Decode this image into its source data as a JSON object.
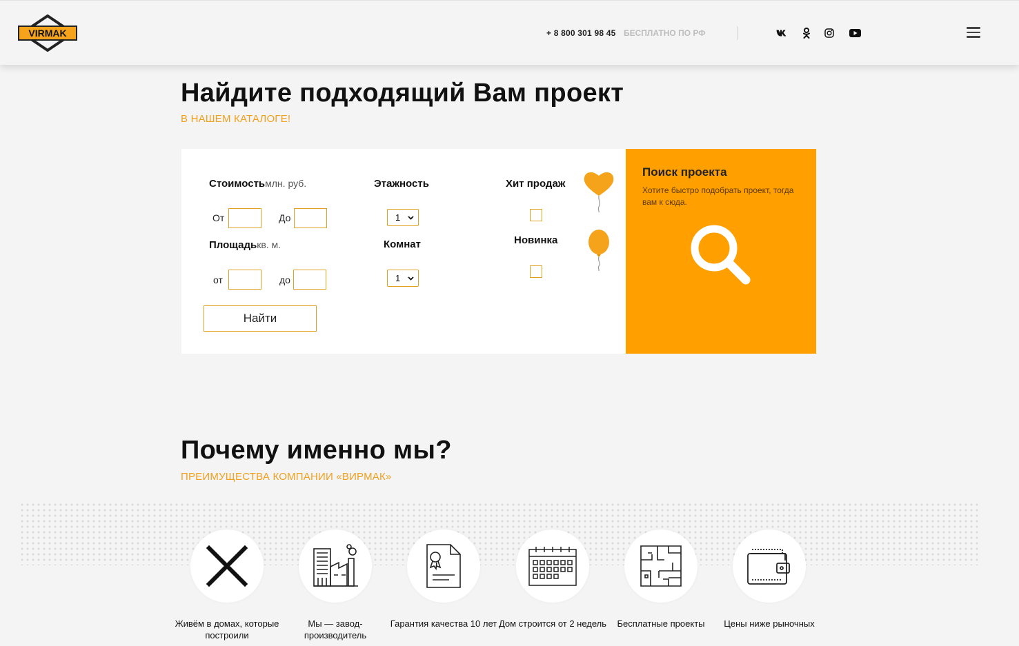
{
  "brand": {
    "logo_text": "VIRMAK",
    "accent": "#ff9f00"
  },
  "header": {
    "phone": "+ 8 800 301 98 45",
    "phone_note": "БЕСПЛАТНО ПО РФ",
    "social": [
      "vk-icon",
      "odnoklassniki-icon",
      "instagram-icon",
      "youtube-icon"
    ]
  },
  "search_section": {
    "title": "Найдите подходящий Вам проект",
    "subtitle": "В НАШЕМ КАТАЛОГЕ!",
    "cost_label": "Стоимость",
    "cost_unit": "млн. руб.",
    "cost_from": "От",
    "cost_to": "До",
    "area_label": "Площадь",
    "area_unit": "кв. м.",
    "area_from": "от",
    "area_to": "до",
    "floors_label": "Этажность",
    "floors_value": "1",
    "rooms_label": "Комнат",
    "rooms_value": "1",
    "hit_label": "Хит продаж",
    "new_label": "Новинка",
    "find_button": "Найти"
  },
  "search_card": {
    "title": "Поиск проекта",
    "text": "Хотите быстро подобрать проект, тогда вам к сюда."
  },
  "why_section": {
    "title": "Почему именно мы?",
    "subtitle": "ПРЕИМУЩЕСТВА КОМПАНИИ «ВИРМАК»",
    "items": [
      {
        "icon": "close-icon",
        "label": "Живём в домах, которые построили"
      },
      {
        "icon": "factory-icon",
        "label": "Мы — завод-производитель"
      },
      {
        "icon": "certificate-icon",
        "label": "Гарантия качества 10 лет"
      },
      {
        "icon": "calendar-icon",
        "label": "Дом строится от 2 недель"
      },
      {
        "icon": "floor-plan-icon",
        "label": "Бесплатные проекты"
      },
      {
        "icon": "wallet-icon",
        "label": "Цены ниже рыночных"
      }
    ]
  }
}
